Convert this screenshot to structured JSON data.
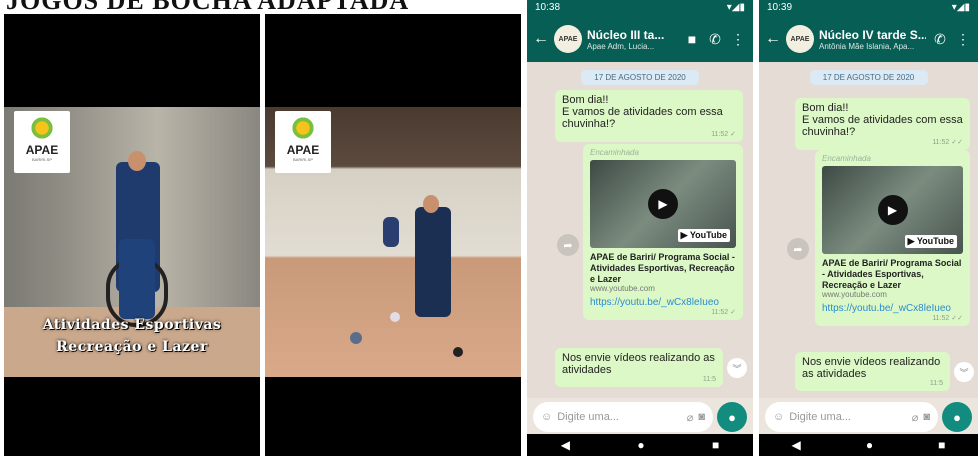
{
  "title": "JOGOS DE BOCHA ADAPTADA",
  "videos": [
    {
      "logo_name": "APAE",
      "logo_sub": "BARIRI-SP",
      "caption_line1": "Atividades Esportivas",
      "caption_line2": "Recreação e Lazer"
    },
    {
      "logo_name": "APAE",
      "logo_sub": "BARIRI-SP"
    }
  ],
  "phones": [
    {
      "status_time": "10:38",
      "status_icons": "▾◢▮",
      "group_name": "Núcleo III ta...",
      "group_members": "Apae Adm, Lucia...",
      "date_chip": "17 DE AGOSTO DE 2020",
      "msg1_text": "Bom dia!!\nE vamos de atividades com essa chuvinha!?",
      "msg1_time": "11:52 ✓",
      "forwarded": "Encaminhada",
      "yt_badge": "▶ YouTube",
      "link_title": "APAE de Bariri/ Programa Social - Atividades Esportivas, Recreação e Lazer",
      "link_domain": "www.youtube.com",
      "link_url": "https://youtu.be/_wCx8leIueo",
      "msg2_time": "11:52 ✓",
      "msg3_text": "Nos envie vídeos realizando as atividades",
      "msg3_time": "11:5",
      "input_placeholder": "Digite uma..."
    },
    {
      "status_time": "10:39",
      "status_icons": "▾◢▮",
      "group_name": "Núcleo IV tarde S...",
      "group_members": "Antônia Mãe Islania, Apa...",
      "date_chip": "17 DE AGOSTO DE 2020",
      "msg1_text": "Bom dia!!\nE vamos de atividades com essa chuvinha!?",
      "msg1_time": "11:52 ✓✓",
      "forwarded": "Encaminhada",
      "yt_badge": "▶ YouTube",
      "link_title": "APAE de Bariri/ Programa Social - Atividades Esportivas, Recreação e Lazer",
      "link_domain": "www.youtube.com",
      "link_url": "https://youtu.be/_wCx8leIueo",
      "msg2_time": "11:52 ✓✓",
      "msg3_text": "Nos envie vídeos realizando as atividades",
      "msg3_time": "11:5",
      "input_placeholder": "Digite uma..."
    }
  ],
  "colors": {
    "whatsapp_header": "#075e54",
    "bubble": "#dcf8c6",
    "link": "#2a8bd0"
  }
}
